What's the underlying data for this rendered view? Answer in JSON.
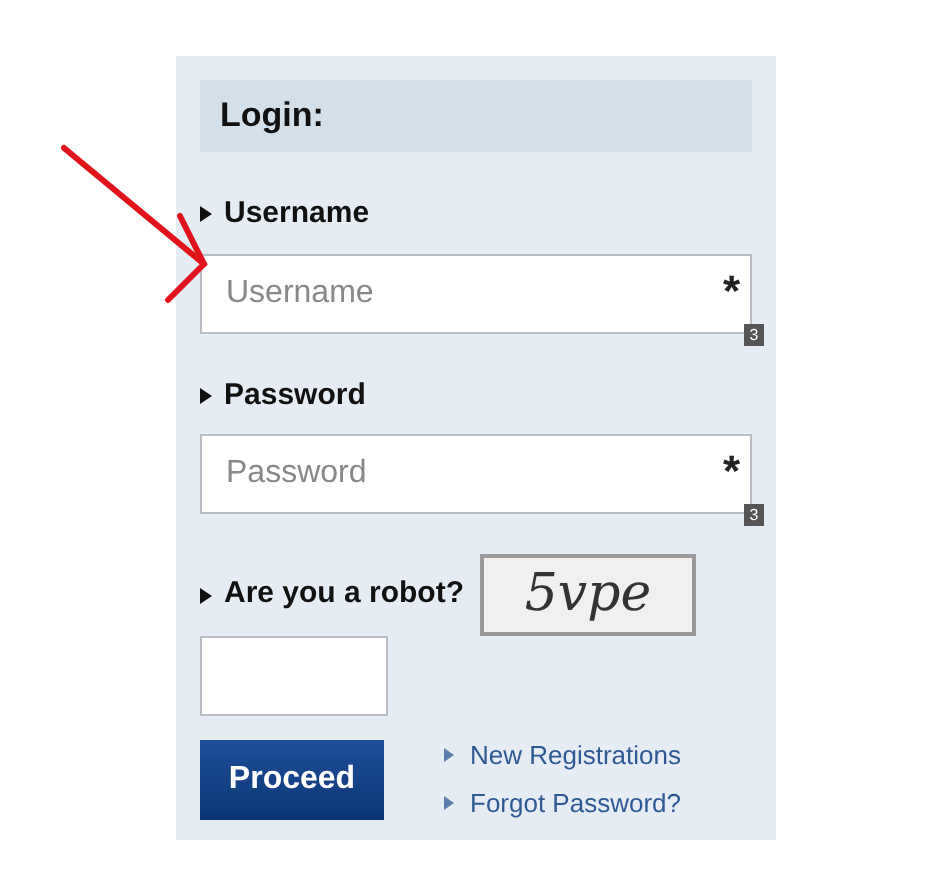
{
  "panel": {
    "title": "Login:"
  },
  "fields": [
    {
      "label": "Username",
      "placeholder": "Username",
      "required_mark": "*",
      "badge": "3"
    },
    {
      "label": "Password",
      "placeholder": "Password",
      "required_mark": "*",
      "badge": "3"
    }
  ],
  "captcha": {
    "label": "Are you a robot?",
    "text": "5vpe"
  },
  "submit": "Proceed",
  "links": [
    "New Registrations",
    "Forgot Password?"
  ]
}
